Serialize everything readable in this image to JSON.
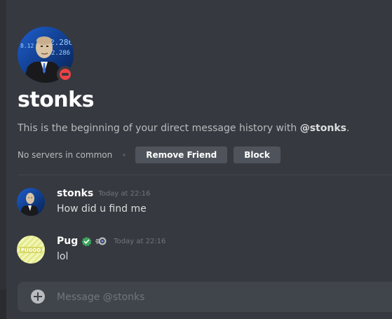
{
  "header": {
    "avatar_icon": "stonks-meme-avatar",
    "status": "do-not-disturb",
    "status_color": "#ed4245",
    "title": "stonks",
    "intro_prefix": "This is the beginning of your direct message history with ",
    "intro_handle": "@stonks",
    "intro_suffix": ".",
    "no_servers": "No servers in common",
    "remove_friend_label": "Remove Friend",
    "block_label": "Block"
  },
  "messages": [
    {
      "author": "stonks",
      "time": "Today at 22:16",
      "text": "How did u find me",
      "avatar_icon": "stonks-meme-avatar"
    },
    {
      "author": "Pug",
      "time": "Today at 22:16",
      "text": "lol",
      "avatar_icon": "pugod-avatar",
      "avatar_text": "PUGOD",
      "badges": [
        "verified-badge-icon",
        "nitro-boost-icon"
      ]
    }
  ],
  "composer": {
    "placeholder": "Message @stonks",
    "value": ""
  },
  "colors": {
    "background": "#36393f",
    "button": "#4f545c",
    "verified": "#3ba55c",
    "composer": "#40444b"
  }
}
